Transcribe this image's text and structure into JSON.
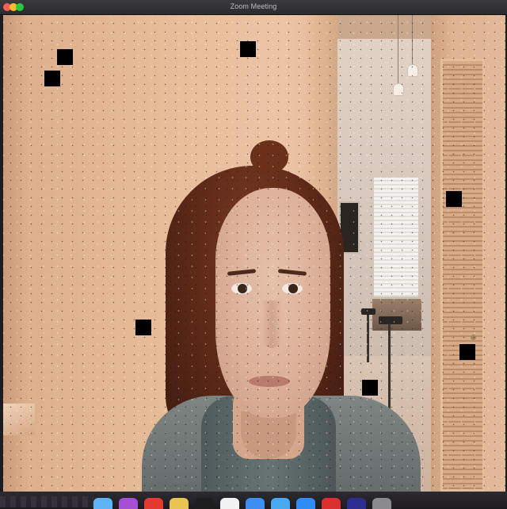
{
  "window": {
    "title": "Zoom Meeting",
    "traffic_lights": [
      "close",
      "minimize",
      "maximize"
    ]
  },
  "video": {
    "participant_feed": "camera-video"
  },
  "dock": {
    "items": [
      {
        "icon": "finder-icon",
        "color": "#5fb4f5"
      },
      {
        "icon": "podcasts-icon",
        "color": "#a44fd4"
      },
      {
        "icon": "calendar-app-icon",
        "color": "#e33b2f"
      },
      {
        "icon": "notes-icon",
        "color": "#e8c452"
      },
      {
        "icon": "terminal-icon",
        "color": "#1e1e1e"
      },
      {
        "icon": "photos-icon",
        "color": "#f2f2f2"
      },
      {
        "icon": "mail-icon",
        "color": "#3d8ef0"
      },
      {
        "icon": "safari-icon",
        "color": "#4aa8f0"
      },
      {
        "icon": "app-store-icon",
        "color": "#2f8cf2"
      },
      {
        "icon": "record-icon",
        "color": "#d9322e"
      },
      {
        "icon": "video-window-icon",
        "color": "#2b2e8f"
      },
      {
        "icon": "system-icon",
        "color": "#8a8a8f"
      }
    ]
  }
}
